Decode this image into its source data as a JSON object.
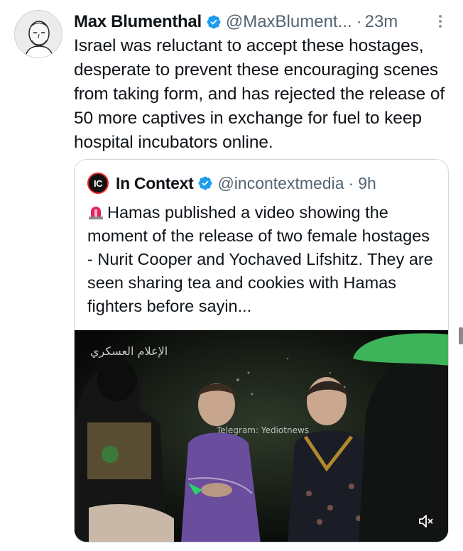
{
  "tweet": {
    "author_name": "Max Blumenthal",
    "handle": "@MaxBlument...",
    "separator": "·",
    "time": "23m",
    "text": "Israel was reluctant to accept these hostages, desperate to prevent these encouraging scenes from taking form, and has rejected the release of 50 more captives in exchange for fuel to keep hospital incubators online."
  },
  "quoted_tweet": {
    "avatar_text": "IC",
    "author_name": "In Context",
    "handle": "@incontextmedia",
    "separator": "·",
    "time": "9h",
    "text": "Hamas published a video showing the moment of the release of two female hostages - Nurit Cooper and Yochaved Lifshitz. They are seen sharing tea and cookies with Hamas fighters before sayin...",
    "media": {
      "channel_logo_text": "الإعلام العسكري",
      "watermark_text": "Telegram: Yediotnews",
      "mute_icon": "speaker-muted-icon"
    }
  },
  "icons": {
    "verified": "verified-badge-icon",
    "more": "more-options-icon",
    "siren": "siren-icon"
  },
  "colors": {
    "verified_blue": "#1d9bf0",
    "secondary_text": "#536471",
    "border": "#cfd9de"
  }
}
